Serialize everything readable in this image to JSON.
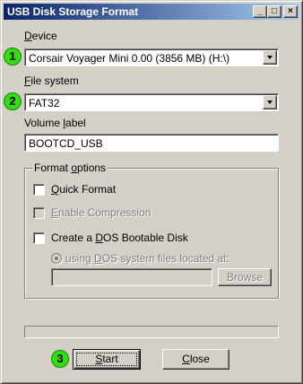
{
  "window": {
    "title": "USB Disk Storage Format",
    "controls": {
      "minimize": "_",
      "maximize": "□",
      "close": "×"
    }
  },
  "device": {
    "label_accel": "D",
    "label_rest": "evice",
    "value": "Corsair Voyager Mini 0.00 (3856 MB) (H:\\)",
    "badge": "1"
  },
  "file_system": {
    "label_accel": "F",
    "label_rest": "ile system",
    "value": "FAT32",
    "badge": "2"
  },
  "volume_label": {
    "label_pre": "Volume ",
    "label_accel": "l",
    "label_rest": "abel",
    "value": "BOOTCD_USB"
  },
  "format_options": {
    "legend_pre": "Format ",
    "legend_accel": "o",
    "legend_rest": "ptions",
    "quick_format": {
      "label_pre": "",
      "label_accel": "Q",
      "label_rest": "uick Format",
      "checked": false
    },
    "enable_compression": {
      "label_pre": "",
      "label_accel": "E",
      "label_rest": "nable Compression",
      "checked": false,
      "enabled": false
    },
    "dos_bootable": {
      "label_pre": "Create a ",
      "label_accel": "D",
      "label_rest": "OS Bootable Disk",
      "checked": false
    },
    "dos_source": {
      "label_pre": "using ",
      "label_accel": "D",
      "label_rest": "OS system files located at:",
      "enabled": false
    },
    "path_value": "",
    "browse_label": "Browse"
  },
  "progress": {
    "value": 0
  },
  "buttons": {
    "start_accel": "S",
    "start_rest": "tart",
    "start_badge": "3",
    "close_accel": "C",
    "close_rest": "lose"
  },
  "colors": {
    "titlebar_start": "#0a246a",
    "titlebar_end": "#a6caf0",
    "badge": "#33dd11",
    "face": "#d4d0c8"
  }
}
